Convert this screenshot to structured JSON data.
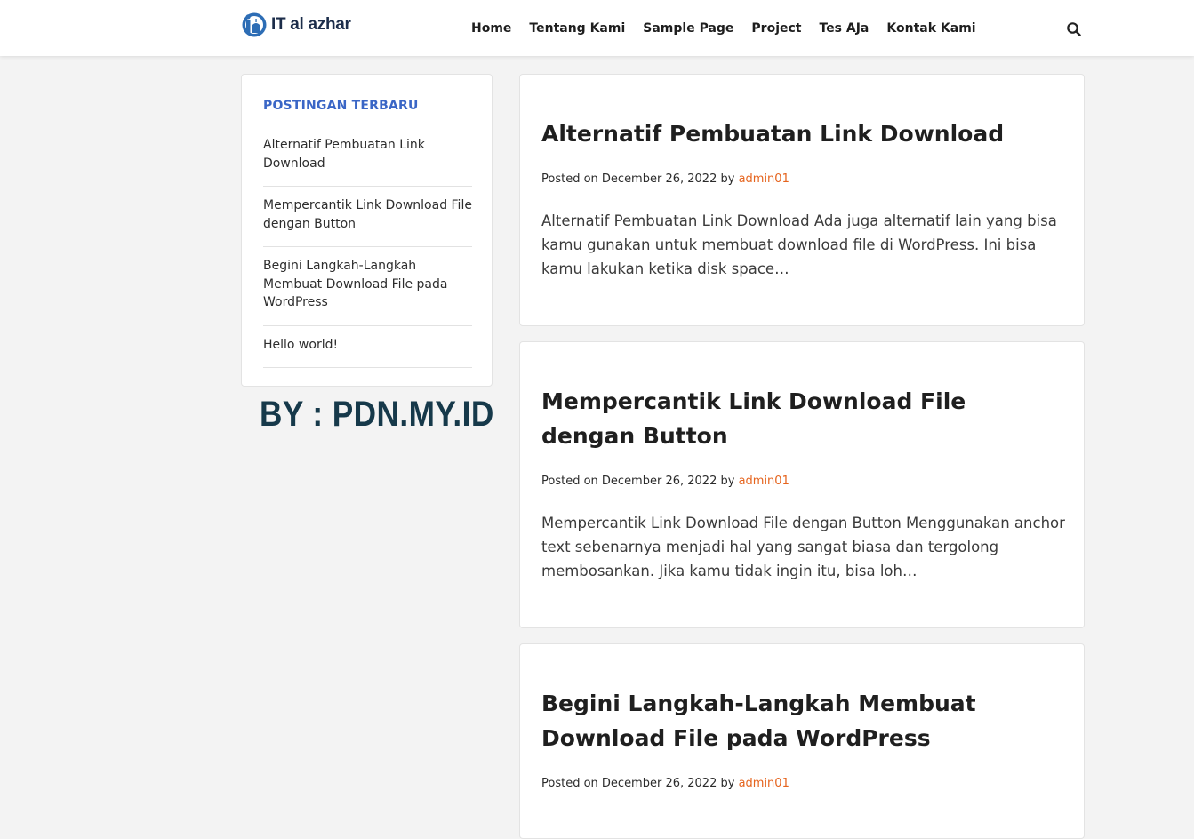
{
  "header": {
    "logo_text": "IT al azhar",
    "nav": [
      "Home",
      "Tentang Kami",
      "Sample Page",
      "Project",
      "Tes AJa",
      "Kontak Kami"
    ],
    "search_icon": "search-icon"
  },
  "sidebar": {
    "widget_title": "POSTINGAN TERBARU",
    "items": [
      "Alternatif Pembuatan Link Download",
      "Mempercantik Link Download File dengan Button",
      "Begini Langkah-Langkah Membuat Download File pada WordPress",
      "Hello world!"
    ],
    "watermark": "BY : PDN.MY.ID"
  },
  "posts": [
    {
      "title": "Alternatif Pembuatan Link Download",
      "meta_prefix": "Posted on December 26, 2022 by ",
      "author": "admin01",
      "excerpt": "Alternatif Pembuatan Link Download Ada juga alternatif lain yang bisa kamu gunakan untuk membuat download file di WordPress. Ini bisa kamu lakukan ketika disk space…"
    },
    {
      "title": "Mempercantik Link Download File dengan Button",
      "meta_prefix": "Posted on December 26, 2022 by ",
      "author": "admin01",
      "excerpt": "Mempercantik Link Download File dengan Button Menggunakan anchor text sebenarnya menjadi hal yang sangat biasa dan tergolong membosankan. Jika kamu tidak ingin itu, bisa loh…"
    },
    {
      "title": "Begini Langkah-Langkah Membuat Download File pada WordPress",
      "meta_prefix": "Posted on December 26, 2022 by ",
      "author": "admin01"
    }
  ],
  "colors": {
    "accent_link": "#e5641e",
    "widget_title": "#3a66c6",
    "watermark": "#16394a",
    "background": "#f3f3f3"
  }
}
